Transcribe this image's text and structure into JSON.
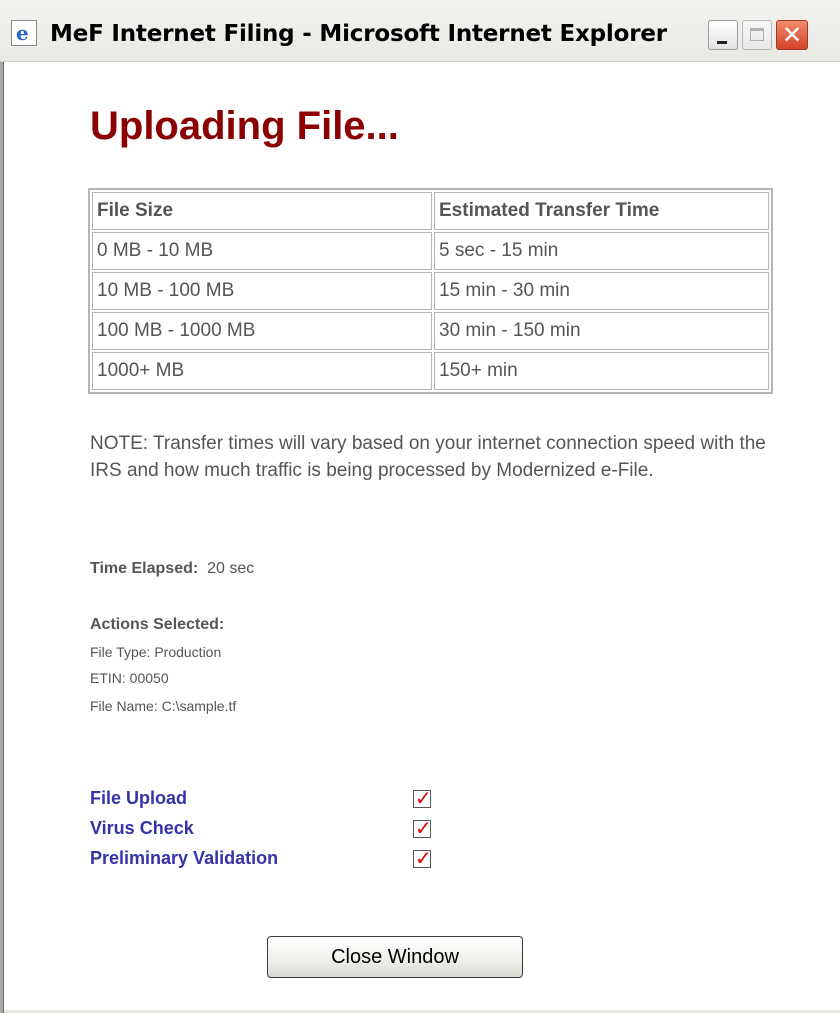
{
  "window": {
    "title": "MeF Internet Filing - Microsoft Internet Explorer",
    "icon": "internet-explorer-icon",
    "controls": {
      "minimize": "minimize-icon",
      "maximize": "maximize-icon",
      "close": "close-icon"
    }
  },
  "page": {
    "heading": "Uploading File...",
    "table": {
      "headers": [
        "File Size",
        "Estimated Transfer Time"
      ],
      "rows": [
        [
          "0 MB - 10 MB",
          "5 sec - 15 min"
        ],
        [
          "10 MB - 100 MB",
          "15 min - 30 min"
        ],
        [
          "100 MB - 1000 MB",
          "30 min - 150 min"
        ],
        [
          "1000+ MB",
          "150+ min"
        ]
      ]
    },
    "note": "NOTE: Transfer times will vary based on your internet connection speed with the IRS and how much traffic is being processed by Modernized e-File.",
    "elapsed": {
      "label": "Time Elapsed:",
      "value": "20 sec"
    },
    "actions": {
      "title": "Actions Selected:",
      "file_type": "File Type:  Production",
      "etin": "ETIN:  00050",
      "file_name": "File Name:  C:\\sample.tf"
    },
    "status": [
      {
        "label": "File Upload",
        "checked": true,
        "mark": "✓"
      },
      {
        "label": "Virus Check",
        "checked": true,
        "mark": "✓"
      },
      {
        "label": "Preliminary Validation",
        "checked": true,
        "mark": "✓"
      }
    ],
    "close_button": "Close Window"
  },
  "colors": {
    "heading": "#8b0000",
    "status_label": "#3333aa",
    "check_mark": "#e00000",
    "text": "#555555"
  }
}
